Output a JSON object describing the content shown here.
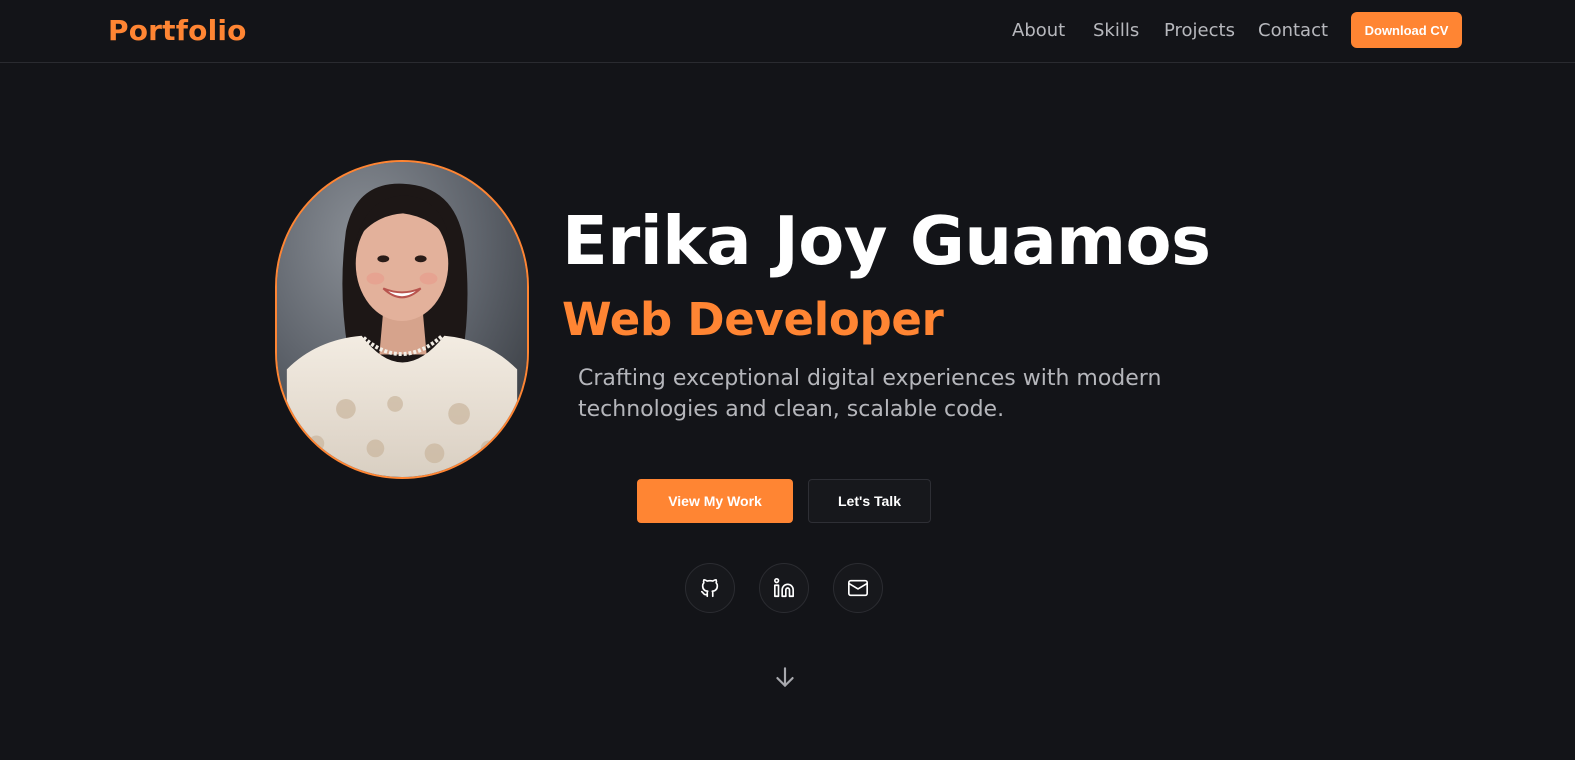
{
  "brand": "Portfolio",
  "nav": {
    "items": [
      "About",
      "Skills",
      "Projects",
      "Contact"
    ],
    "download_label": "Download CV"
  },
  "hero": {
    "name": "Erika Joy Guamos",
    "role": "Web Developer",
    "description": "Crafting exceptional digital experiences with modern technologies and clean, scalable code.",
    "primary_button": "View My Work",
    "secondary_button": "Let's Talk"
  },
  "social": [
    "github-icon",
    "linkedin-icon",
    "mail-icon"
  ],
  "scroll_icon": "arrow-down-icon",
  "colors": {
    "accent": "#ff8533",
    "background": "#131418",
    "text": "#ffffff",
    "muted": "#b5b6bb"
  }
}
